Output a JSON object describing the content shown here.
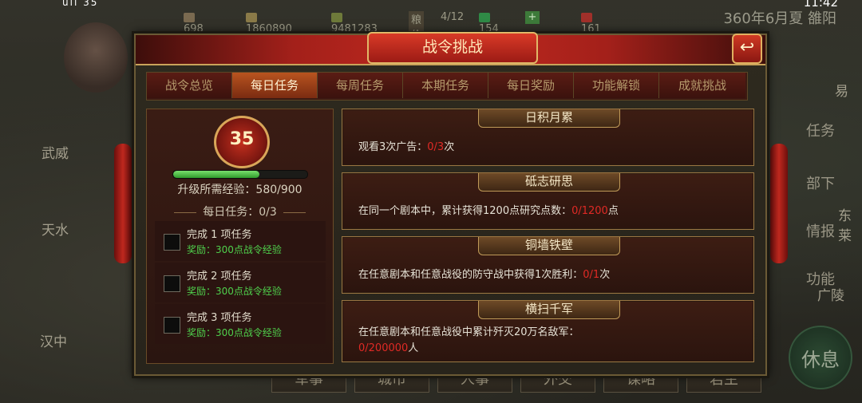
{
  "status_bar": {
    "left_icons": "ull 35",
    "time": "11:42"
  },
  "resources": [
    {
      "icon": "population-icon",
      "value": "698",
      "color": "#7a6a50"
    },
    {
      "icon": "money-icon",
      "value": "1860890",
      "color": "#8a7a48"
    },
    {
      "icon": "grain-icon",
      "value": "9481283",
      "color": "#6e7a3a"
    },
    {
      "icon": "food-price-label",
      "value": "粮价",
      "color": "#6a5a44"
    },
    {
      "icon": "food-price-value",
      "value": "4/12",
      "color": "#6a5a44"
    },
    {
      "icon": "gold-ingot-icon",
      "value": "154",
      "color": "#2f8a46"
    },
    {
      "icon": "add-icon",
      "value": "+",
      "color": "#3d7a3a"
    },
    {
      "icon": "token-icon",
      "value": "161",
      "color": "#a0302a"
    }
  ],
  "date_label": "360年6月夏 雒阳",
  "map_labels": [
    "武威",
    "天水",
    "汉中",
    "易",
    "东莱",
    "广陵"
  ],
  "right_menu": [
    "任务",
    "部下",
    "情报",
    "功能"
  ],
  "rest_button": "休息",
  "bottom_tabs": [
    "军事",
    "城市",
    "人事",
    "外交",
    "谋略",
    "君主"
  ],
  "dialog": {
    "title": "战令挑战",
    "back_icon": "↩",
    "tabs": [
      "战令总览",
      "每日任务",
      "每周任务",
      "本期任务",
      "每日奖励",
      "功能解锁",
      "成就挑战"
    ],
    "active_tab": 1
  },
  "left_panel": {
    "level": "35",
    "exp_label": "升级所需经验：580/900",
    "exp_fraction": 0.644,
    "daily_tasks_label": "每日任务：0/3",
    "milestones": [
      {
        "title": "完成 1 项任务",
        "reward": "奖励：300点战令经验"
      },
      {
        "title": "完成 2 项任务",
        "reward": "奖励：300点战令经验"
      },
      {
        "title": "完成 3 项任务",
        "reward": "奖励：300点战令经验"
      }
    ]
  },
  "tasks": [
    {
      "name": "日积月累",
      "desc_pre": "观看3次广告：",
      "progress": "0/3",
      "desc_post": "次"
    },
    {
      "name": "砥志研思",
      "desc_pre": "在同一个剧本中，累计获得1200点研究点数：",
      "progress": "0/1200",
      "desc_post": "点"
    },
    {
      "name": "铜墙铁壁",
      "desc_pre": "在任意剧本和任意战役的防守战中获得1次胜利：",
      "progress": "0/1",
      "desc_post": "次"
    },
    {
      "name": "横扫千军",
      "desc_pre": "在任意剧本和任意战役中累计歼灭20万名敌军：",
      "progress": "0/200000",
      "desc_post": "人"
    }
  ]
}
